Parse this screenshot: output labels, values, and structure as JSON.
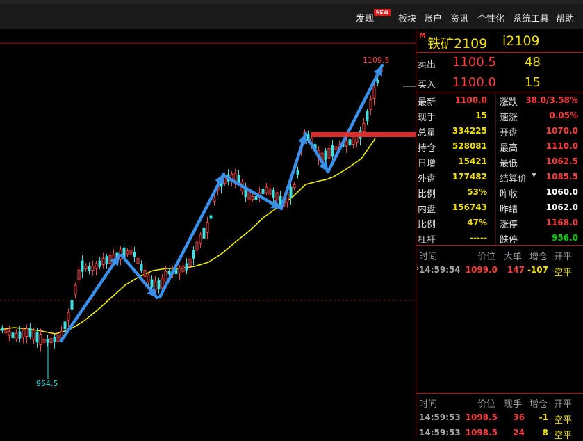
{
  "menu": {
    "items": [
      "发现",
      "板块",
      "账户",
      "资讯",
      "个性化",
      "系统工具",
      "帮助"
    ],
    "new_badge": "NEW"
  },
  "chart": {
    "high_label": "1109.5",
    "low_label": "964.5",
    "flag": "M"
  },
  "quote": {
    "name": "铁矿2109",
    "code": "i2109",
    "ask_label": "卖出",
    "ask_price": "1100.5",
    "ask_volume": "48",
    "bid_label": "买入",
    "bid_price": "1100.0",
    "bid_volume": "15",
    "stats_left": [
      {
        "label": "最新",
        "value": "1100.0"
      },
      {
        "label": "现手",
        "value": "15"
      },
      {
        "label": "总量",
        "value": "334225"
      },
      {
        "label": "持仓",
        "value": "528081"
      },
      {
        "label": "日增",
        "value": "15421"
      },
      {
        "label": "外盘",
        "value": "177482"
      },
      {
        "label": "比例",
        "value": "53%"
      },
      {
        "label": "内盘",
        "value": "156743"
      },
      {
        "label": "比例",
        "value": "47%"
      },
      {
        "label": "杠杆",
        "value": "-----"
      }
    ],
    "stats_right": [
      {
        "label": "涨跌",
        "value": "38.0/3.58%"
      },
      {
        "label": "速涨",
        "value": "0.05%"
      },
      {
        "label": "开盘",
        "value": "1070.0"
      },
      {
        "label": "最高",
        "value": "1110.0"
      },
      {
        "label": "最低",
        "value": "1062.5"
      },
      {
        "label": "结算价",
        "value": "1085.5"
      },
      {
        "label": "昨收",
        "value": "1060.0"
      },
      {
        "label": "昨结",
        "value": "1062.0"
      },
      {
        "label": "涨停",
        "value": "1168.0"
      },
      {
        "label": "跌停",
        "value": "956.0"
      }
    ]
  },
  "ticks_top": {
    "headers": [
      "时间",
      "价位",
      "大单",
      "增仓",
      "开平"
    ],
    "rows": [
      {
        "time": "14:59:54",
        "price": "1099.0",
        "vol": "147",
        "chg": "-107",
        "type": "空平"
      }
    ]
  },
  "ticks_bottom": {
    "headers": [
      "时间",
      "价位",
      "现手",
      "增仓",
      "开平"
    ],
    "rows": [
      {
        "time": "14:59:53",
        "price": "1098.5",
        "vol": "36",
        "chg": "-1",
        "type": "空平"
      },
      {
        "time": "14:59:53",
        "price": "1098.5",
        "vol": "24",
        "chg": "8",
        "type": "空平"
      }
    ]
  }
}
